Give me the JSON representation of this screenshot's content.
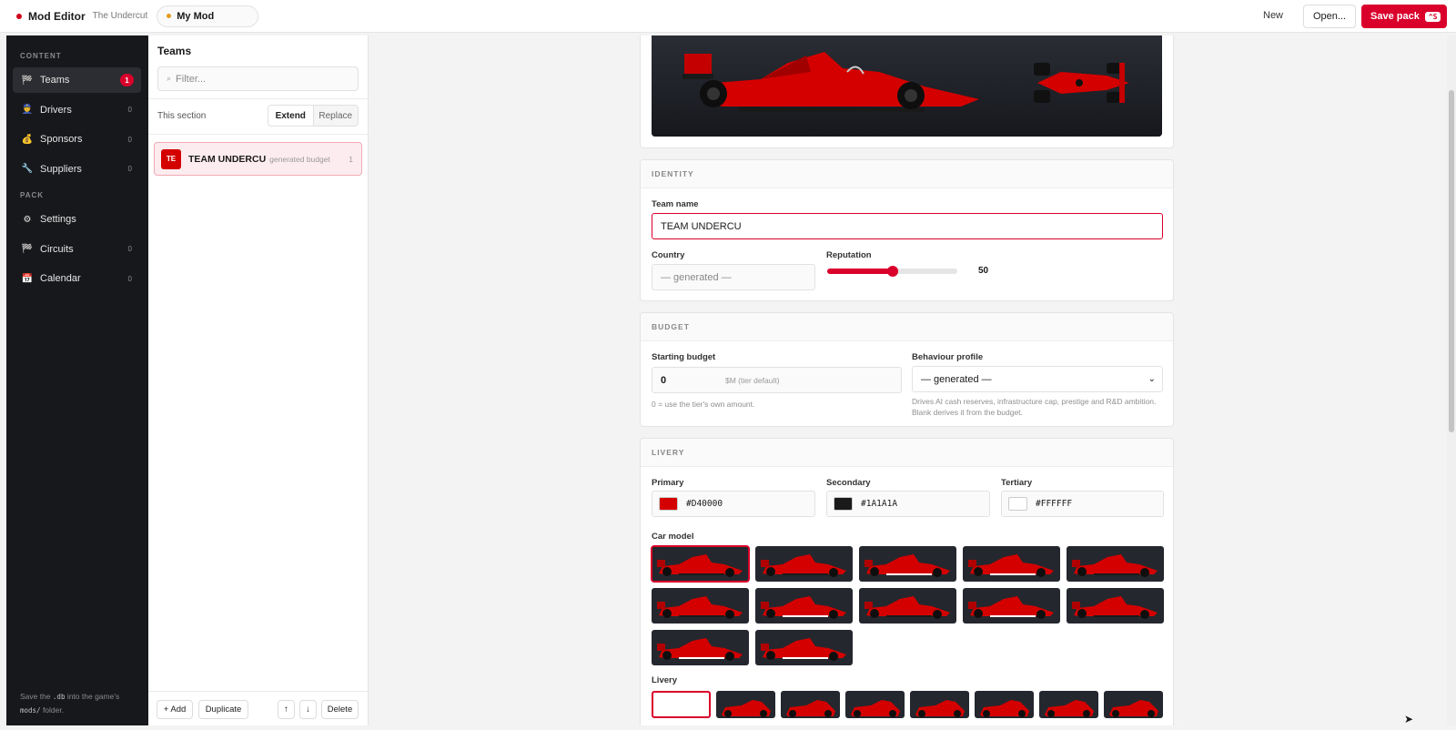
{
  "topbar": {
    "app_title": "Mod Editor",
    "app_subtitle": "The Undercut",
    "mod_name": "My Mod",
    "new_label": "New",
    "open_label": "Open...",
    "save_label": "Save pack",
    "save_shortcut": "^S",
    "accent_color": "#d9002b"
  },
  "sidebar": {
    "content_heading": "CONTENT",
    "pack_heading": "PACK",
    "content_items": [
      {
        "label": "Teams",
        "count": "1",
        "icon": "flag-icon",
        "glyph": "🏁"
      },
      {
        "label": "Drivers",
        "count": "0",
        "icon": "driver-icon",
        "glyph": "👮"
      },
      {
        "label": "Sponsors",
        "count": "0",
        "icon": "money-bag-icon",
        "glyph": "💰"
      },
      {
        "label": "Suppliers",
        "count": "0",
        "icon": "wrench-icon",
        "glyph": "🔧"
      }
    ],
    "pack_items": [
      {
        "label": "Settings",
        "icon": "gear-icon",
        "glyph": "⚙"
      },
      {
        "label": "Circuits",
        "count": "0",
        "icon": "flag-icon",
        "glyph": "🏁"
      },
      {
        "label": "Calendar",
        "count": "0",
        "icon": "calendar-icon",
        "glyph": "📅"
      }
    ],
    "footer": {
      "pre": "Save the ",
      "code1": ".db",
      "mid": " into the game's ",
      "code2": "mods/",
      "post": " folder."
    }
  },
  "list": {
    "title": "Teams",
    "filter_placeholder": "Filter...",
    "section_label": "This section",
    "extend_label": "Extend",
    "replace_label": "Replace",
    "items": [
      {
        "badge": "TE",
        "name": "TEAM UNDERCU",
        "meta": "generated budget",
        "num": "1",
        "color": "#d40000"
      }
    ],
    "add_label": "+ Add",
    "duplicate_label": "Duplicate",
    "up_label": "↑",
    "down_label": "↓",
    "delete_label": "Delete"
  },
  "identity": {
    "heading": "IDENTITY",
    "team_name_label": "Team name",
    "team_name_value": "TEAM UNDERCU",
    "country_label": "Country",
    "country_placeholder": "— generated —",
    "reputation_label": "Reputation",
    "reputation_value": "50",
    "reputation_fraction": 0.5
  },
  "budget": {
    "heading": "BUDGET",
    "starting_label": "Starting budget",
    "starting_value": "0",
    "starting_unit": "$M (tier default)",
    "starting_hint": "0 = use the tier's own amount.",
    "behaviour_label": "Behaviour profile",
    "behaviour_value": "— generated —",
    "behaviour_hint": "Drives AI cash reserves, infrastructure cap, prestige and R&D ambition. Blank derives it from the budget."
  },
  "livery": {
    "heading": "LIVERY",
    "primary_label": "Primary",
    "primary_hex": "#D40000",
    "secondary_label": "Secondary",
    "secondary_hex": "#1A1A1A",
    "tertiary_label": "Tertiary",
    "tertiary_hex": "#FFFFFF",
    "car_model_label": "Car model",
    "livery_label": "Livery",
    "car_model_count": 12,
    "livery_count": 8
  }
}
